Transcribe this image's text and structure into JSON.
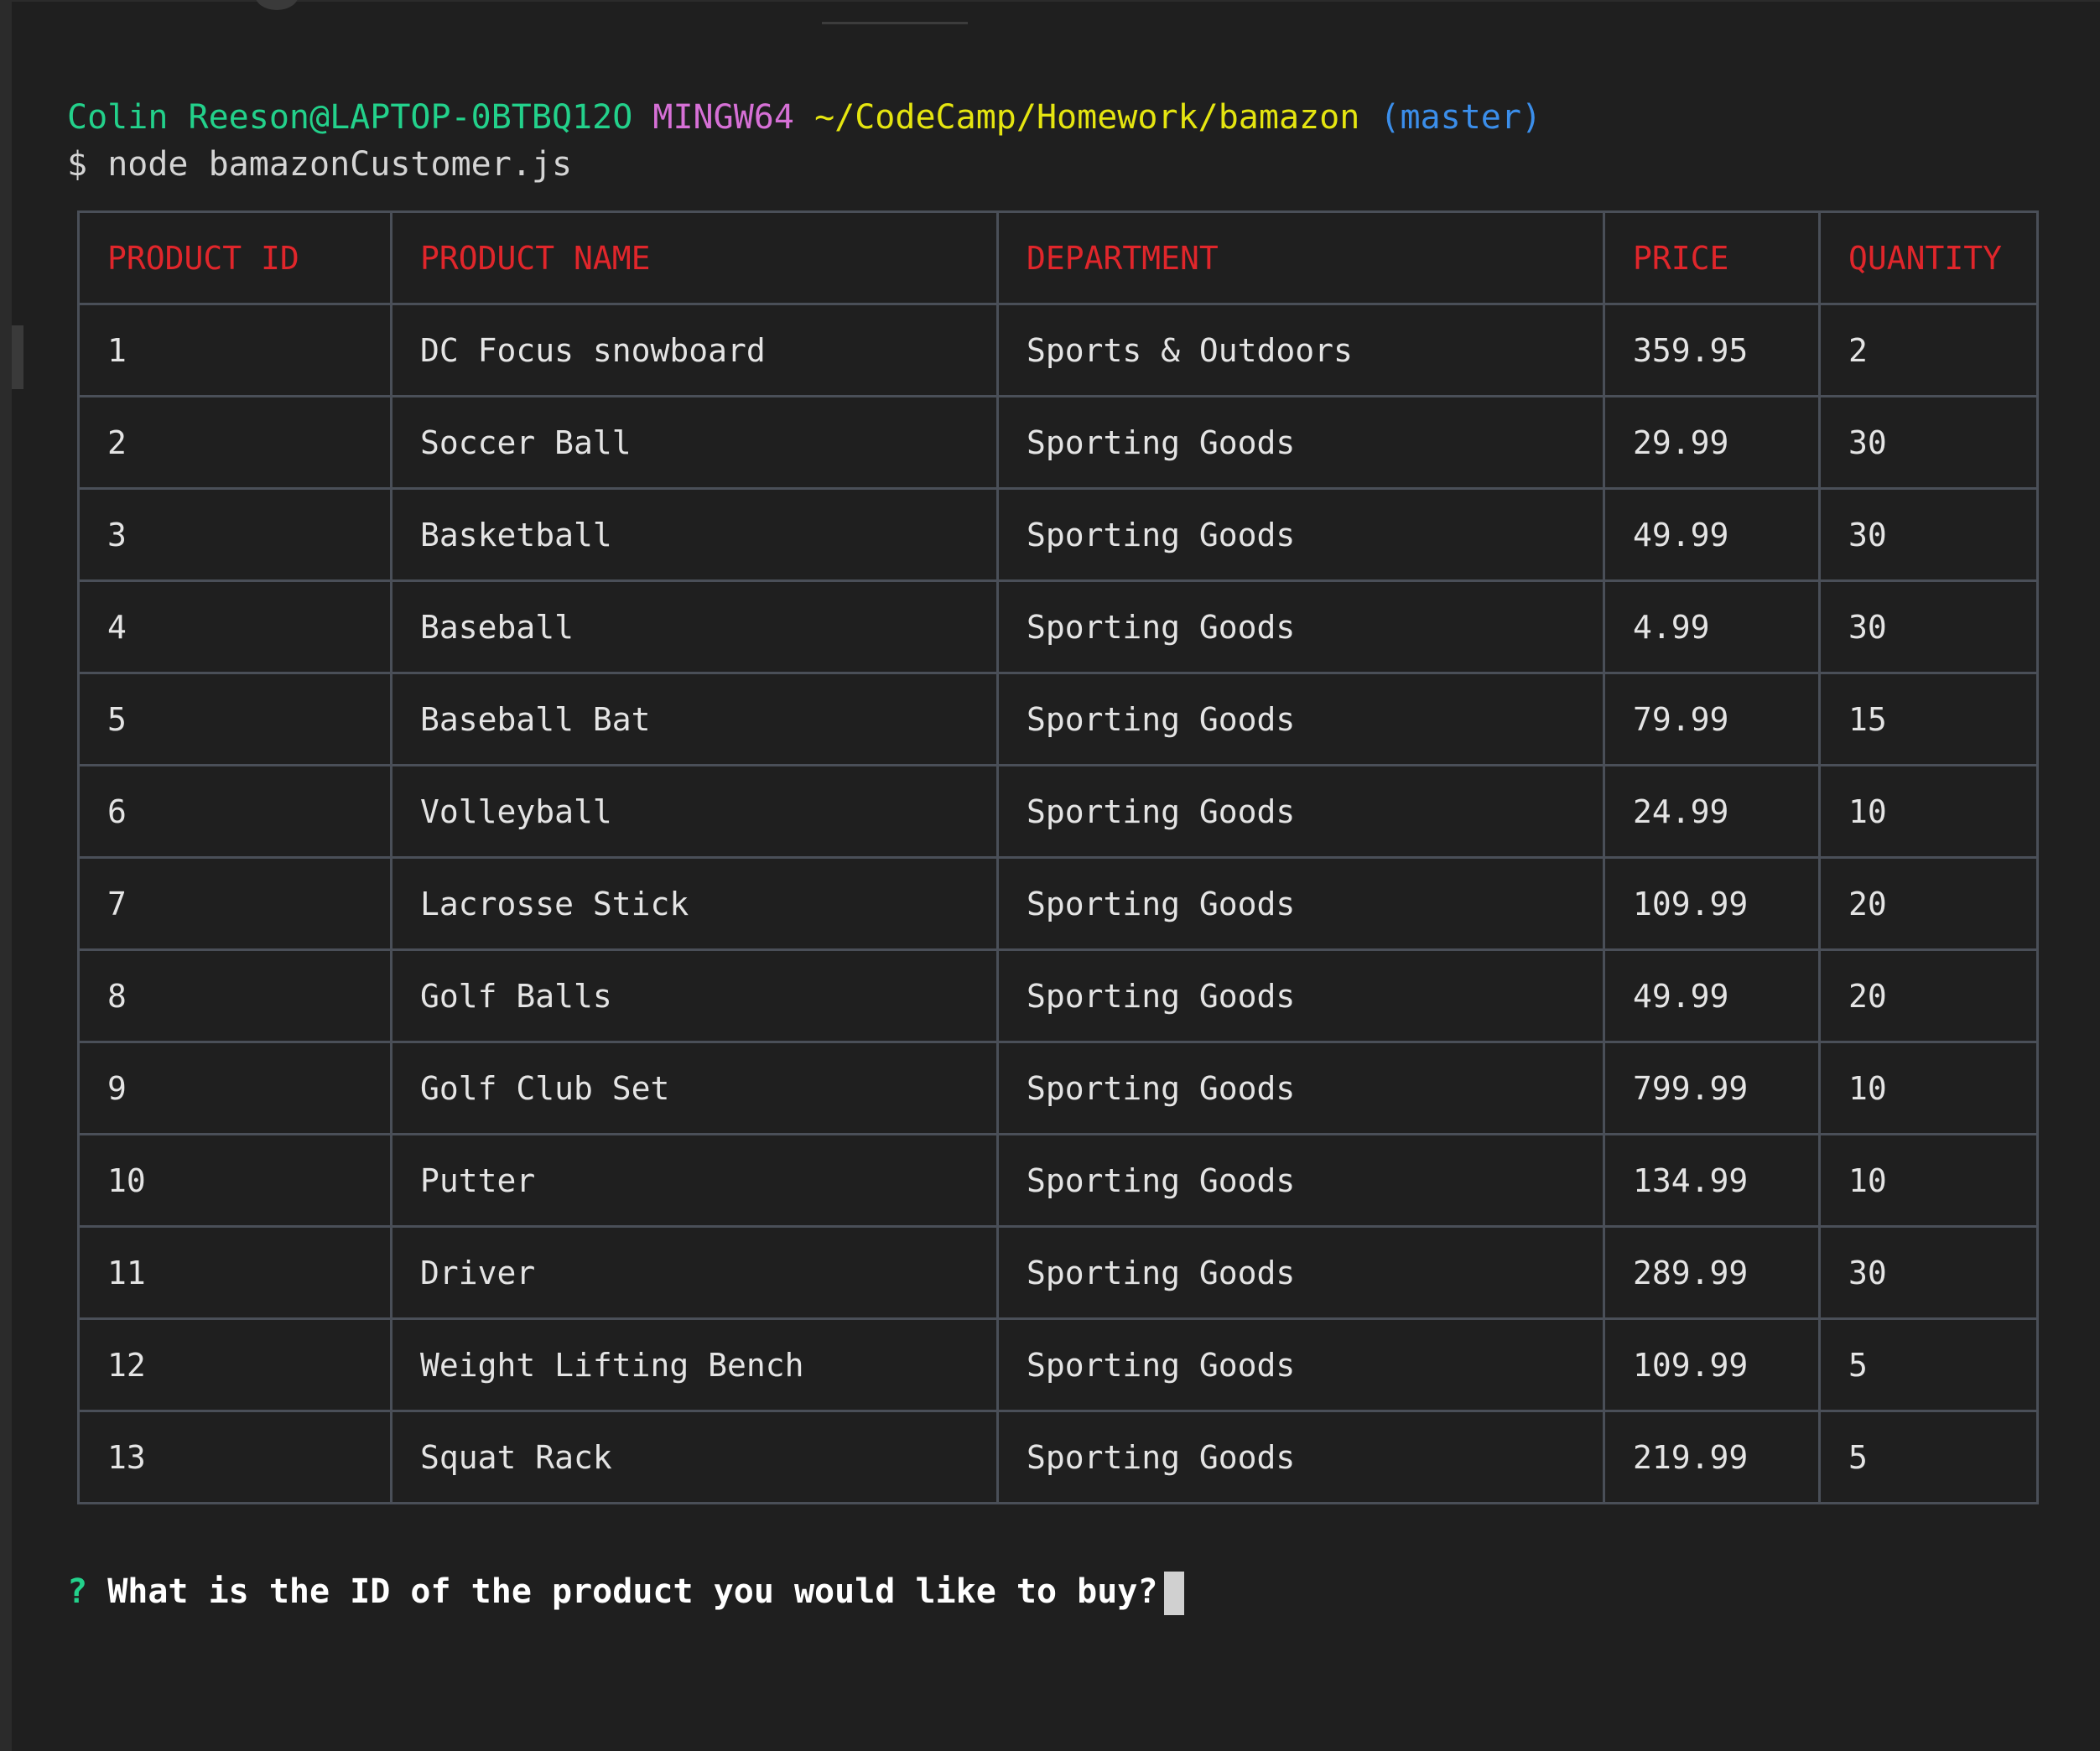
{
  "prompt": {
    "user_host": "Colin Reeson@LAPTOP-0BTBQ12O",
    "system": "MINGW64",
    "path": "~/CodeCamp/Homework/bamazon",
    "branch": "(master)"
  },
  "command": {
    "symbol": "$",
    "text": "node bamazonCustomer.js"
  },
  "table": {
    "headers": [
      "PRODUCT ID",
      "PRODUCT NAME",
      "DEPARTMENT",
      "PRICE",
      "QUANTITY"
    ],
    "rows": [
      [
        "1",
        "DC Focus snowboard",
        "Sports & Outdoors",
        "359.95",
        "2"
      ],
      [
        "2",
        "Soccer Ball",
        "Sporting Goods",
        "29.99",
        "30"
      ],
      [
        "3",
        "Basketball",
        "Sporting Goods",
        "49.99",
        "30"
      ],
      [
        "4",
        "Baseball",
        "Sporting Goods",
        "4.99",
        "30"
      ],
      [
        "5",
        "Baseball Bat",
        "Sporting Goods",
        "79.99",
        "15"
      ],
      [
        "6",
        "Volleyball",
        "Sporting Goods",
        "24.99",
        "10"
      ],
      [
        "7",
        "Lacrosse Stick",
        "Sporting Goods",
        "109.99",
        "20"
      ],
      [
        "8",
        "Golf Balls",
        "Sporting Goods",
        "49.99",
        "20"
      ],
      [
        "9",
        "Golf Club Set",
        "Sporting Goods",
        "799.99",
        "10"
      ],
      [
        "10",
        "Putter",
        "Sporting Goods",
        "134.99",
        "10"
      ],
      [
        "11",
        "Driver",
        "Sporting Goods",
        "289.99",
        "30"
      ],
      [
        "12",
        "Weight Lifting Bench",
        "Sporting Goods",
        "109.99",
        "5"
      ],
      [
        "13",
        "Squat Rack",
        "Sporting Goods",
        "219.99",
        "5"
      ]
    ]
  },
  "question": {
    "mark": "?",
    "text": "What is the ID of the product you would like to buy?"
  },
  "colors": {
    "background": "#1f1f1f",
    "header_text": "#e0262b",
    "user_host": "#23d18b",
    "system": "#d670d6",
    "path": "#e5e510",
    "branch": "#3b8eea",
    "table_border": "#4a4f58"
  }
}
